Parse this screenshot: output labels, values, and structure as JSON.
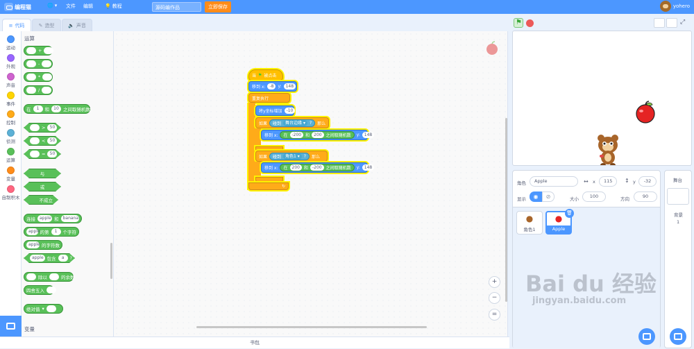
{
  "topbar": {
    "brand": "编程猫",
    "menu": {
      "file": "文件",
      "edit": "编辑",
      "tutorial": "教程"
    },
    "project_title": "源码编作品",
    "save_label": "立即保存",
    "username": "yohero"
  },
  "tabs": {
    "code": "代码",
    "costume": "造型",
    "sound": "声音"
  },
  "categories": [
    {
      "label": "运动",
      "color": "#4c97ff"
    },
    {
      "label": "外观",
      "color": "#9966ff"
    },
    {
      "label": "声音",
      "color": "#cf63cf"
    },
    {
      "label": "事件",
      "color": "#ffd500"
    },
    {
      "label": "控制",
      "color": "#ffab19"
    },
    {
      "label": "侦测",
      "color": "#5cb1d6"
    },
    {
      "label": "运算",
      "color": "#59c059"
    },
    {
      "label": "变量",
      "color": "#ff8c1a"
    },
    {
      "label": "自制积木",
      "color": "#ff6680"
    }
  ],
  "palette": {
    "section_title": "运算",
    "random": {
      "from": "在",
      "a": "1",
      "and": "和",
      "b": "10",
      "suffix": "之间取随机数"
    },
    "gt_val": "50",
    "lt_val": "50",
    "eq_val": "50",
    "gt_sym": ">",
    "lt_sym": "<",
    "eq_sym": "=",
    "and_label": "与",
    "or_label": "或",
    "not_label": "不成立",
    "join": {
      "prefix": "连接",
      "a": "apple",
      "and": "和",
      "b": "banana"
    },
    "letter": {
      "a": "apple",
      "of": "的第",
      "n": "1",
      "suffix": "个字符"
    },
    "length": {
      "a": "apple",
      "suffix": "的字符数"
    },
    "contains": {
      "a": "apple",
      "mid": "包含",
      "b": "a",
      "q": "?"
    },
    "mod": {
      "mid": "除以",
      "suffix": "的余数"
    },
    "round_label": "四舍五入",
    "abs_label": "绝对值",
    "next_section": "变量"
  },
  "script": {
    "when_flag": "当",
    "clicked": "被点击",
    "goto_label": "移到 x:",
    "goto_x": "-8",
    "goto_y_label": "y:",
    "goto_y": "148",
    "forever": "重复执行",
    "change_y": "将y坐标增加",
    "change_y_val": "-10",
    "if1": "如果",
    "touching": "碰到",
    "edge": "舞台边缘",
    "q": "?",
    "then": "那么",
    "set_x_label": "移到 x:",
    "in": "在",
    "r1a": "-200",
    "r_and": "和",
    "r1b": "200",
    "r_suffix": "之间取随机数",
    "y_label": "y:",
    "set_y": "148",
    "sprite1": "角色1",
    "r2a": "200",
    "r2b": "-200"
  },
  "backpack_label": "书包",
  "sprite_panel": {
    "sprite_label": "角色",
    "sprite_name": "Apple",
    "x_label": "x",
    "x_value": "115",
    "y_label": "y",
    "y_value": "-32",
    "show_label": "显示",
    "size_label": "大小",
    "size_value": "100",
    "direction_label": "方向",
    "direction_value": "90",
    "sprites": [
      "角色1",
      "Apple"
    ]
  },
  "stage_panel": {
    "title": "舞台",
    "backdrop_label": "背景",
    "backdrop_count": "1"
  },
  "watermark": {
    "top": "Bai du 经验",
    "bottom": "jingyan.baidu.com"
  }
}
